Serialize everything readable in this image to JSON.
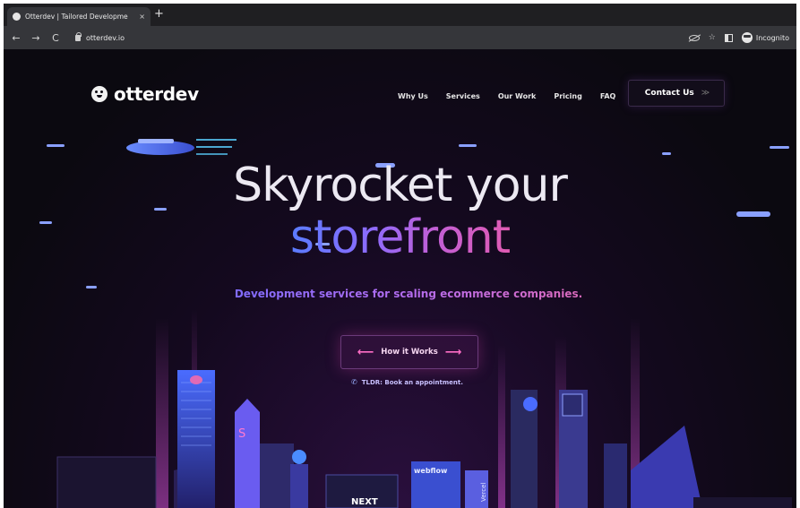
{
  "browser": {
    "tab_title": "Otterdev | Tailored Developme",
    "tab_close": "×",
    "new_tab": "+",
    "back": "←",
    "forward": "→",
    "reload": "C",
    "url": "otterdev.io",
    "bookmark": "☆",
    "incognito_label": "Incognito"
  },
  "site": {
    "brand": "otterdev",
    "nav": [
      "Why Us",
      "Services",
      "Our Work",
      "Pricing",
      "FAQ"
    ],
    "contact_label": "Contact Us",
    "contact_arrows": "≫",
    "hero_line1": "Skyrocket your",
    "hero_line2": "storefront",
    "subtitle": "Development services for scaling ecommerce companies.",
    "how_label": "How it Works",
    "how_left_arrow": "⟵",
    "how_right_arrow": "⟶",
    "tldr_icon": "✆",
    "tldr_label": "TLDR: Book an appointment.",
    "city_logos": {
      "s_letter": "S",
      "webflow": "webflow",
      "next": "NEXT",
      "vercel": "Vercel"
    }
  },
  "icons": {
    "favicon": "otter-favicon",
    "logo": "otter-icon",
    "incognito": "incognito-icon"
  },
  "colors": {
    "background": "#0c0912",
    "gradient_start": "#5a7cff",
    "gradient_end": "#e05bb3",
    "accent_pink": "#ff6ec7"
  }
}
